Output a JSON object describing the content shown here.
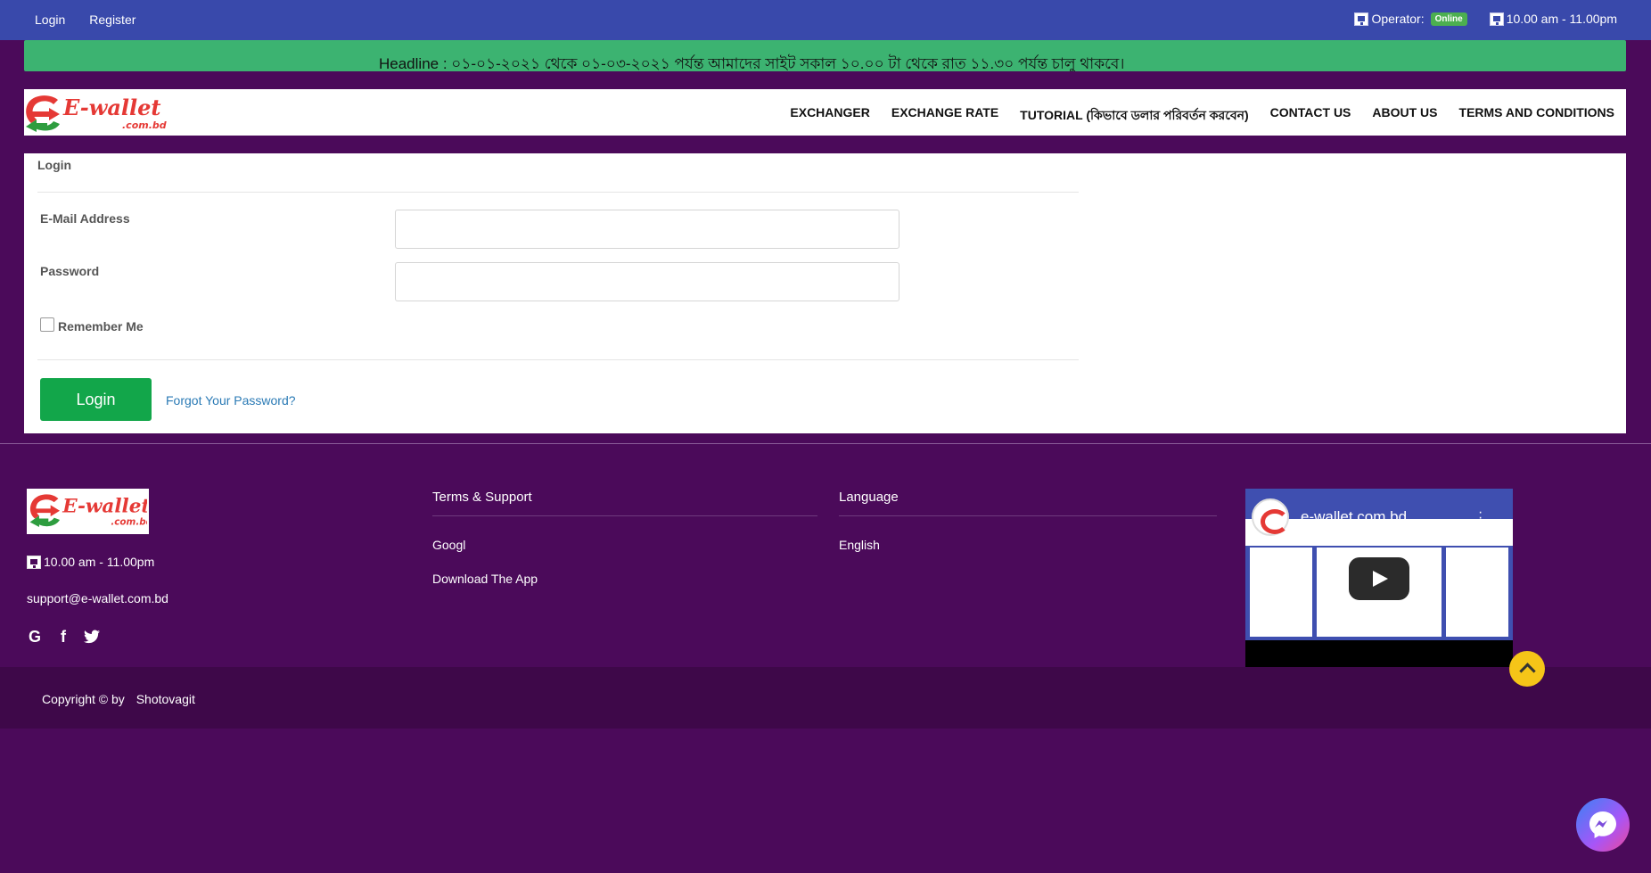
{
  "topbar": {
    "login": "Login",
    "register": "Register",
    "operator_label": "Operator:",
    "operator_status": "Online",
    "hours": "10.00 am - 11.00pm",
    "bg_color": "#3949ab"
  },
  "headline": {
    "label": "Headline :",
    "text": "০১-০১-২০২১ থেকে ০১-০৩-২০২১ পর্যন্ত আমাদের সাইট সকাল ১০.০০ টা থেকে রাত ১১.৩০  পর্যন্ত চালু থাকবে।",
    "bg_color": "#3cb371"
  },
  "logo": {
    "text": "E-wallet",
    "subtext": ".com.bd"
  },
  "nav": {
    "items": [
      "EXCHANGER",
      "EXCHANGE RATE",
      "TUTORIAL (কিভাবে ডলার পরিবর্তন করবেন)",
      "CONTACT US",
      "ABOUT US",
      "TERMS AND CONDITIONS"
    ]
  },
  "login_form": {
    "title": "Login",
    "email_label": "E-Mail Address",
    "email_value": "",
    "password_label": "Password",
    "password_value": "",
    "remember_label": "Remember Me",
    "remember_checked": false,
    "submit_label": "Login",
    "forgot_label": "Forgot Your Password?",
    "button_color": "#12a64a"
  },
  "footer": {
    "hours": "10.00 am - 11.00pm",
    "email": "support@e-wallet.com.bd",
    "social_icons": [
      "google-icon",
      "facebook-icon",
      "twitter-icon"
    ],
    "terms_heading": "Terms & Support",
    "terms_links": [
      "Googl",
      "Download The App"
    ],
    "language_heading": "Language",
    "language_links": [
      "English"
    ],
    "video_title": "e-wallet.com.bd",
    "copyright": "Copyright © by",
    "copyright_owner": "Shotovagit",
    "bg_color": "#4b0a5a"
  }
}
